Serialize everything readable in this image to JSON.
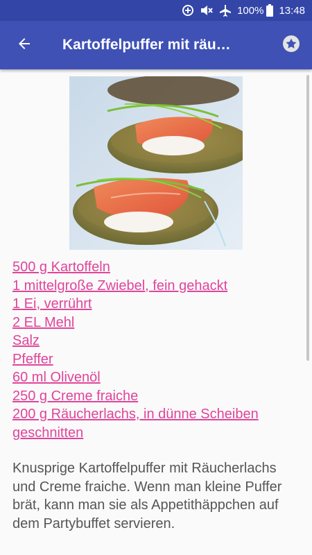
{
  "status_bar": {
    "battery_percent": "100%",
    "time": "13:48",
    "icons": [
      "data-saver-icon",
      "mute-icon",
      "airplane-mode-icon",
      "battery-icon"
    ]
  },
  "app_bar": {
    "title": "Kartoffelpuffer mit räu…",
    "back_icon": "arrow-left-icon",
    "favorite_icon": "star-icon"
  },
  "recipe": {
    "image_alt": "potato-pancakes-with-smoked-salmon-photo",
    "ingredients": [
      "500 g Kartoffeln",
      "1 mittelgroße Zwiebel, fein gehackt",
      "1 Ei, verrührt",
      "2 EL Mehl",
      "Salz",
      "Pfeffer",
      "60 ml Olivenöl",
      "250 g Creme fraiche",
      "200 g Räucherlachs, in dünne Scheiben geschnitten"
    ],
    "description": "Knusprige Kartoffelpuffer mit Räucherlachs und Creme fraiche. Wenn man kleine Puffer brät, kann man sie als Appetithäppchen auf dem Partybuffet servieren."
  },
  "colors": {
    "status_bar": "#3346a8",
    "app_bar": "#3f51b5",
    "ingredient_link": "#e0449a",
    "body_text": "#555555",
    "background": "#fafafa"
  }
}
